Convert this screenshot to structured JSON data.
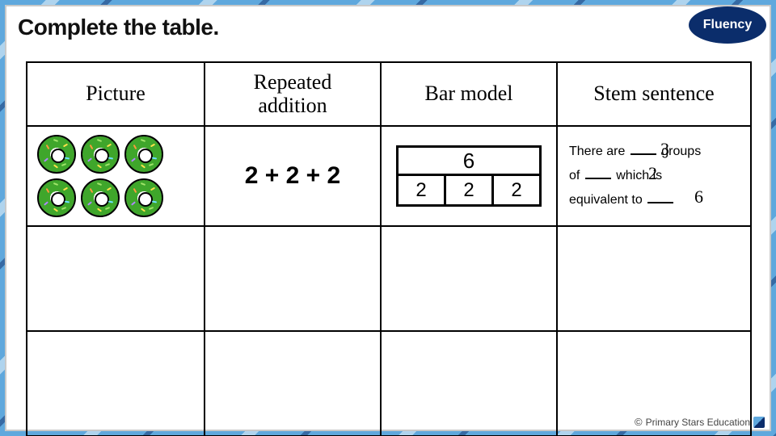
{
  "badge": {
    "label": "Fluency"
  },
  "title": "Complete the table.",
  "table": {
    "headers": {
      "picture": "Picture",
      "repeated_addition": "Repeated\naddition",
      "bar_model": "Bar model",
      "stem_sentence": "Stem sentence"
    },
    "row1": {
      "picture_count": 6,
      "repeated_addition": "2 + 2 + 2",
      "bar_model": {
        "total": "6",
        "parts": [
          "2",
          "2",
          "2"
        ]
      },
      "stem": {
        "line1_a": "There are",
        "line1_b": "groups",
        "line2_a": "of",
        "line2_b": "which is",
        "line3_a": "equivalent to",
        "fill_groups": "3",
        "fill_of": "2",
        "fill_equiv": "6"
      }
    }
  },
  "footer": {
    "copyright": "©",
    "brand": "Primary Stars Education"
  }
}
